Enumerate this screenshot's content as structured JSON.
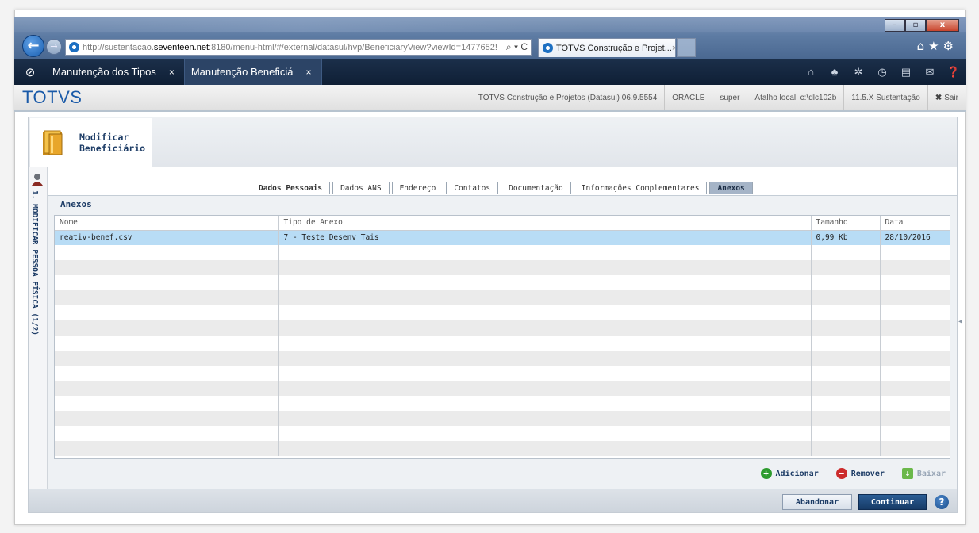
{
  "browser": {
    "url_prefix": "http://sustentacao.",
    "url_domain": "seventeen.net",
    "url_suffix": ":8180/menu-html/#/external/datasul/hvp/BeneficiaryView?viewId=1477652!",
    "tab_title": "TOTVS Construção e Projet...",
    "tab_close": "×",
    "addr_tools": "⌕ ▾ C"
  },
  "appbar": {
    "tabs": [
      {
        "label": "Manutenção dos Tipos",
        "close": "×"
      },
      {
        "label": "Manutenção Beneficiá",
        "close": "×"
      }
    ]
  },
  "header": {
    "logo": "TOTVS",
    "company": "TOTVS Construção e Projetos (Datasul) 06.9.5554",
    "database": "ORACLE",
    "user": "super",
    "shortcut": "Atalho local: c:\\dlc102b",
    "version": "11.5.X Sustentação",
    "logout": "Sair"
  },
  "page": {
    "title_line1": "Modificar",
    "title_line2": "Beneficiário",
    "side_label": "1. MODIFICAR PESSOA FÍSICA (1/2)",
    "tabs": [
      "Dados Pessoais",
      "Dados ANS",
      "Endereço",
      "Contatos",
      "Documentação",
      "Informações Complementares",
      "Anexos"
    ]
  },
  "section": {
    "title": "Anexos",
    "columns": [
      "Nome",
      "Tipo de Anexo",
      "Tamanho",
      "Data"
    ],
    "rows": [
      {
        "nome": "reativ-benef.csv",
        "tipo": "7 - Teste Desenv Tais",
        "tamanho": "0,99 Kb",
        "data": "28/10/2016"
      }
    ],
    "actions": {
      "add": "Adicionar",
      "remove": "Remover",
      "download": "Baixar"
    }
  },
  "footer": {
    "abandon": "Abandonar",
    "continue": "Continuar",
    "help": "?"
  },
  "colors": {
    "brand_blue": "#1a5aa8",
    "nav_dark": "#0f1f35",
    "selected_row": "#b8dcf5"
  }
}
